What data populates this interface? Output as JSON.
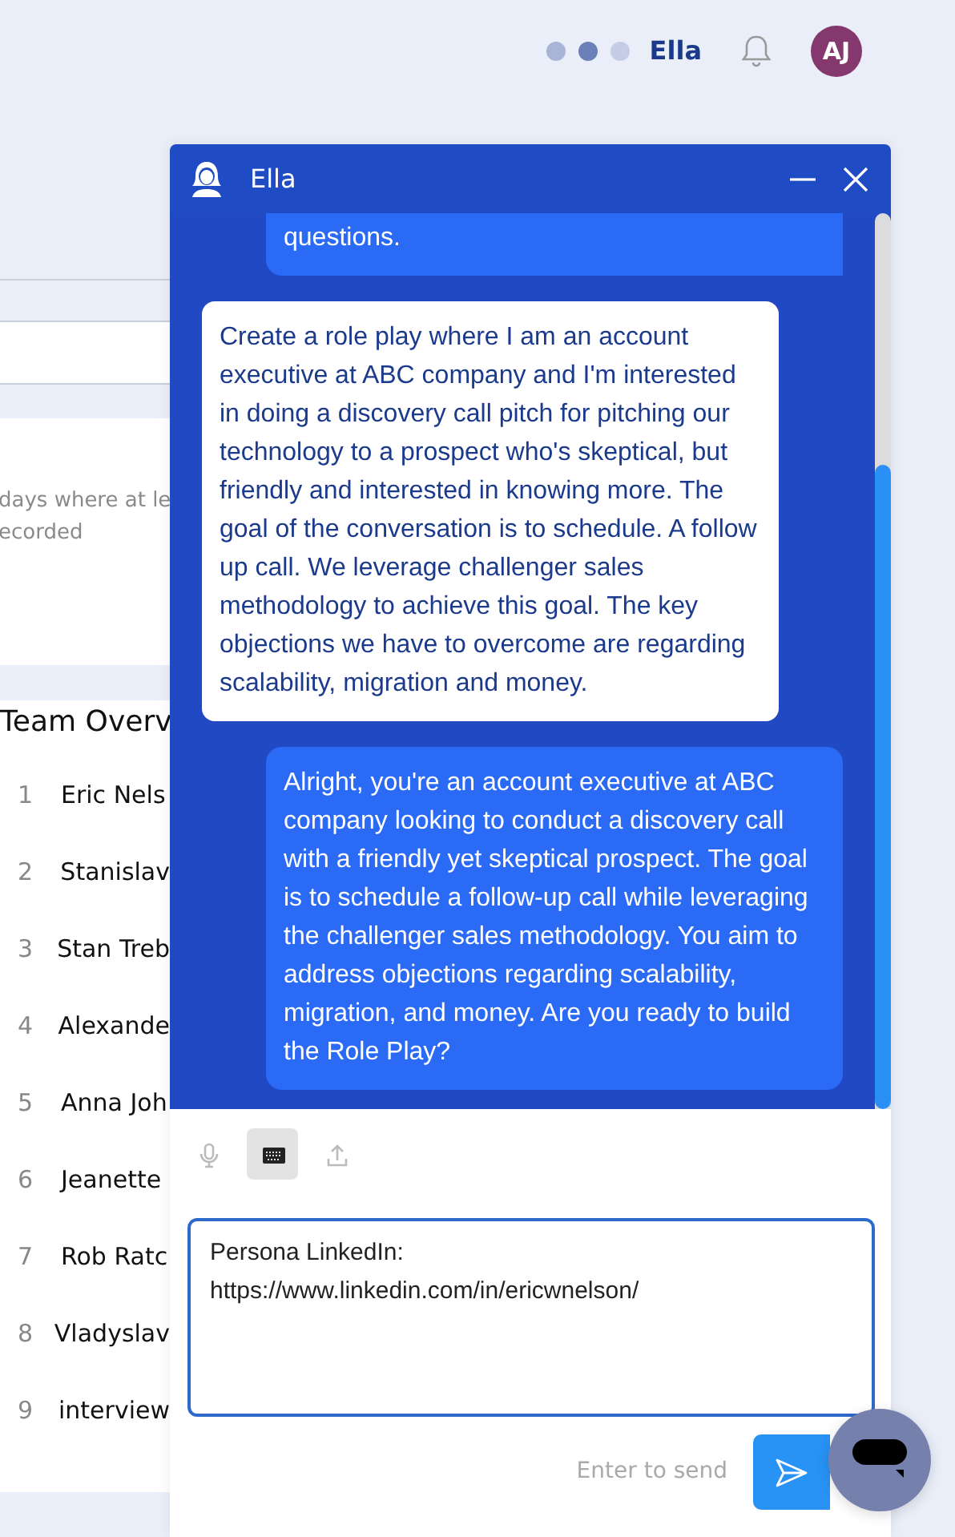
{
  "header": {
    "assistant_name": "Ella",
    "avatar_initials": "AJ"
  },
  "background": {
    "card_text_lines": [
      "days where at le",
      "ecorded"
    ],
    "team_title": "Team Overv",
    "team_rows": [
      {
        "rank": "1",
        "name": "Eric Nels"
      },
      {
        "rank": "2",
        "name": "Stanislav"
      },
      {
        "rank": "3",
        "name": "Stan Treb"
      },
      {
        "rank": "4",
        "name": "Alexande"
      },
      {
        "rank": "5",
        "name": "Anna Joh"
      },
      {
        "rank": "6",
        "name": "Jeanette"
      },
      {
        "rank": "7",
        "name": "Rob Ratc"
      },
      {
        "rank": "8",
        "name": "Vladyslav"
      },
      {
        "rank": "9",
        "name": "interview"
      }
    ]
  },
  "chat": {
    "title": "Ella",
    "messages": [
      {
        "kind": "assistant",
        "text": "questions."
      },
      {
        "kind": "user",
        "text": "Create a role play where I am an account executive at ABC company and I'm interested in doing a discovery call pitch for pitching our technology to a prospect who's skeptical, but friendly and interested in knowing more. The goal of the conversation is to schedule. A follow up call. We leverage challenger sales methodology to achieve this goal. The key objections we have to overcome are regarding scalability, migration and money."
      },
      {
        "kind": "assistant",
        "text": "Alright, you're an account executive at ABC company looking to conduct a discovery call with a friendly yet skeptical prospect. The goal is to schedule a follow-up call while leveraging the challenger sales methodology. You aim to address objections regarding scalability, migration, and money. Are you ready to build the Role Play?"
      }
    ],
    "tools": [
      {
        "kind": "mic",
        "selected": false
      },
      {
        "kind": "keyboard",
        "selected": true
      },
      {
        "kind": "upload",
        "selected": false
      }
    ],
    "input_value": "Persona LinkedIn:\nhttps://www.linkedin.com/in/ericwnelson/",
    "send_hint": "Enter to send"
  }
}
